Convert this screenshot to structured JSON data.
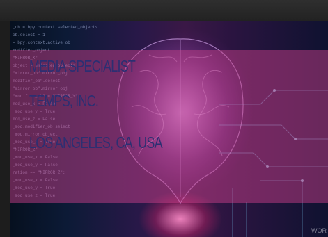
{
  "banner": {
    "line1": "MEDIA SPECIALIST",
    "line2": "TEMPS, INC.",
    "line3": "LOS ANGELES, CA, USA"
  },
  "background": {
    "subject": "brain-circuit-image",
    "code_lines": [
      "_ob = bpy.context.selected_objects",
      "ob.select = 1",
      "= bpy.context.active_ob",
      "modifier_object",
      "\"MIRROR_X\"",
      "object = selected_objects",
      "\"mirror_ob\".mirror_obj",
      "modifier_ob\".select",
      "\"mirror_ob\".mirror_obj",
      "\"modifier_ob\" = \"MIRROR_Y\"",
      "mod_use_x = False",
      "_mod_use_y = True",
      "mod_use_z = False",
      "_mod.modifier_ob.select",
      "_mod.mirror_object",
      "_mod_use_x = True",
      "\"MIRROR_Z\"",
      "_mod_use_x = False",
      "_mod_use_y = False",
      "ration == \"MIRROR_Z\":",
      "_mod_use_x = False",
      "_mod_use_y = True",
      "_mod_use_z = True"
    ]
  },
  "watermark": "WOR"
}
